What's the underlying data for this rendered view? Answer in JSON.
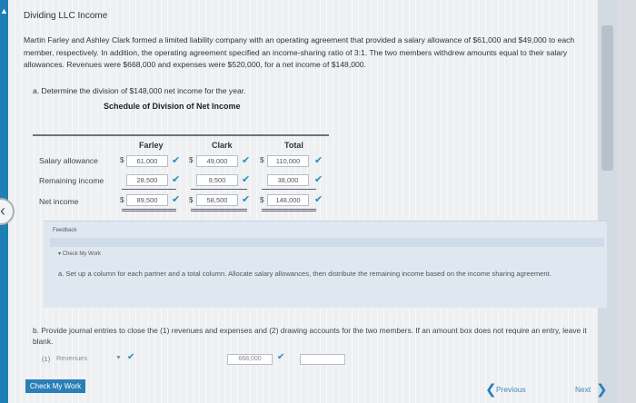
{
  "header": {
    "title": "Dividing LLC Income"
  },
  "problem": {
    "intro": "Martin Farley and Ashley Clark formed a limited liability company with an operating agreement that provided a salary allowance of $61,000 and $49,000 to each member, respectively. In addition, the operating agreement specified an income-sharing ratio of 3:1. The two members withdrew amounts equal to their salary allowances. Revenues were $668,000 and expenses were $520,000, for a net income of $148,000.",
    "part_a": "a. Determine the division of $148,000 net income for the year."
  },
  "schedule": {
    "title": "Schedule of Division of Net Income",
    "columns": [
      "Farley",
      "Clark",
      "Total"
    ],
    "rows": [
      {
        "label": "Salary allowance",
        "values": [
          "61,000",
          "49,000",
          "110,000"
        ]
      },
      {
        "label": "Remaining income",
        "values": [
          "28,500",
          "9,500",
          "38,000"
        ]
      },
      {
        "label": "Net income",
        "values": [
          "89,500",
          "58,500",
          "148,000"
        ]
      }
    ],
    "currency_symbol": "$",
    "check_glyph": "✔"
  },
  "feedback": {
    "label": "Feedback",
    "subheading": "Check My Work",
    "text": "a. Set up a column for each partner and a total column. Allocate salary allowances, then distribute the remaining income based on the income sharing agreement."
  },
  "part_b": {
    "text": "b. Provide journal entries to close the (1) revenues and expenses and (2) drawing accounts for the two members. If an amount box does not require an entry, leave it blank.",
    "entry": {
      "number": "(1)",
      "account": "Revenues",
      "debit": "668,000",
      "credit": ""
    }
  },
  "footer": {
    "check_button": "Check My Work",
    "previous": "Previous",
    "next": "Next"
  },
  "icons": {
    "left_nav": "chevron-left-icon",
    "prev": "chevron-left-icon",
    "next": "chevron-right-icon",
    "dropdown": "caret-down-icon"
  },
  "colors": {
    "accent": "#2b7fb8",
    "check": "#1e8fc4"
  }
}
